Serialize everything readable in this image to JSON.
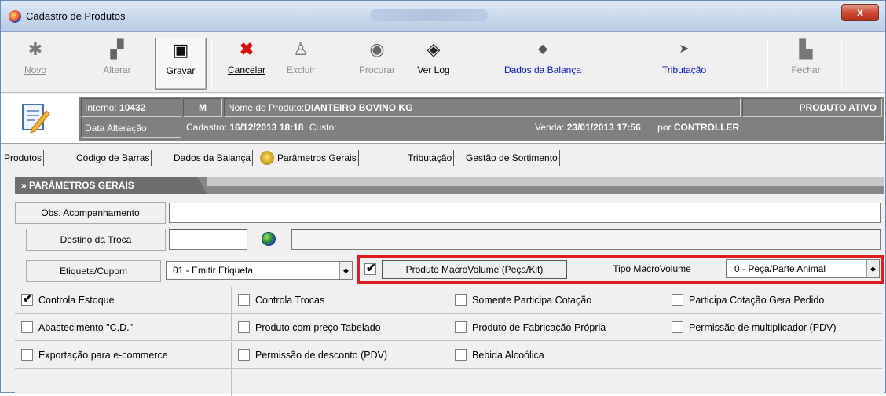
{
  "window": {
    "title": "Cadastro de Produtos",
    "close_glyph": "x"
  },
  "toolbar": {
    "novo": "Novo",
    "alterar": "Alterar",
    "gravar": "Gravar",
    "cancelar": "Cancelar",
    "excluir": "Excluir",
    "procurar": "Procurar",
    "verlog": "Ver Log",
    "dados_balanca": "Dados da Balança",
    "tributacao": "Tributação",
    "fechar": "Fechar"
  },
  "info": {
    "interno_label": "Interno:",
    "interno_value": "10432",
    "m": "M",
    "nome_label": "Nome do Produto:",
    "nome_value": "DIANTEIRO BOVINO KG",
    "status": "PRODUTO ATIVO",
    "data_alteracao_label": "Data Alteração",
    "cadastro_label": "Cadastro:",
    "cadastro_value": "16/12/2013 18:18",
    "custo_label": "Custo:",
    "venda_label": "Venda:",
    "venda_value": "23/01/2013 17:56",
    "por_label": "por",
    "por_value": "CONTROLLER"
  },
  "tabs": [
    "Produtos",
    "Código de Barras",
    "Dados da Balança",
    "Parâmetros Gerais",
    "Tributação",
    "Gestão de Sortimento"
  ],
  "section": {
    "title": "» PARÂMETROS GERAIS"
  },
  "form": {
    "obs_label": "Obs. Acompanhamento",
    "obs_value": "",
    "destino_label": "Destino da Troca",
    "destino_value": "",
    "destino_desc": "",
    "etiqueta_label": "Etiqueta/Cupom",
    "etiqueta_value": "01 - Emitir Etiqueta",
    "macro_label": "Produto MacroVolume (Peça/Kit)",
    "macro_checked": true,
    "tipo_macro_label": "Tipo MacroVolume",
    "tipo_macro_value": "0 - Peça/Parte Animal"
  },
  "checkboxes": [
    [
      {
        "label": "Controla Estoque",
        "checked": true
      },
      {
        "label": "Controla Trocas",
        "checked": false
      },
      {
        "label": "Somente Participa Cotação",
        "checked": false
      },
      {
        "label": "Participa Cotação Gera Pedido",
        "checked": false
      }
    ],
    [
      {
        "label": "Abastecimento \"C.D.\"",
        "checked": false
      },
      {
        "label": "Produto com preço Tabelado",
        "checked": false
      },
      {
        "label": "Produto de Fabricação Própria",
        "checked": false
      },
      {
        "label": "Permissão de multiplicador (PDV)",
        "checked": false
      }
    ],
    [
      {
        "label": "Exportação para e-commerce",
        "checked": false
      },
      {
        "label": "Permissão de desconto (PDV)",
        "checked": false
      },
      {
        "label": "Bebida Alcoólica",
        "checked": false
      }
    ]
  ],
  "colors": {
    "highlight": "#e21b1b",
    "link_blue": "#0018d4",
    "info_bg": "#808080"
  }
}
